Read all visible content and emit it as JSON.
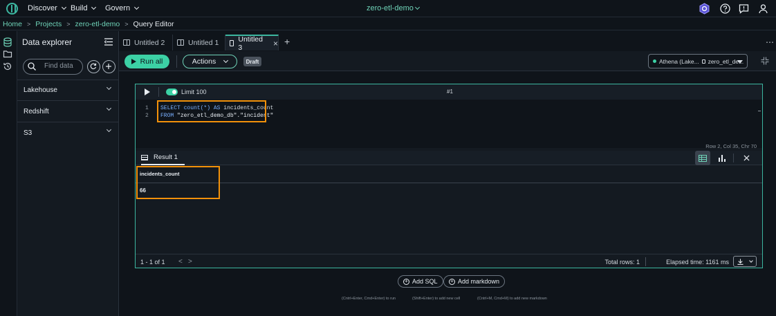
{
  "topnav": {
    "discover": "Discover",
    "build": "Build",
    "govern": "Govern",
    "project": "zero-etl-demo"
  },
  "breadcrumb": {
    "home": "Home",
    "projects": "Projects",
    "project": "zero-etl-demo",
    "current": "Query Editor",
    "separator": ">"
  },
  "explorer": {
    "title": "Data explorer",
    "search_placeholder": "Find data",
    "sections": [
      "Lakehouse",
      "Redshift",
      "S3"
    ]
  },
  "tabs": [
    {
      "label": "Untitled 2"
    },
    {
      "label": "Untitled 1"
    },
    {
      "label": "Untitled 3"
    }
  ],
  "tab_add": "+",
  "tab_close": "×",
  "tab_more": "⋯",
  "toolbar": {
    "run_all": "Run all",
    "actions": "Actions",
    "draft": "Draft",
    "connection": "Athena (Lake...",
    "database": "zero_etl_de..."
  },
  "cell": {
    "limit": "Limit 100",
    "number": "#1",
    "line_numbers": [
      "1",
      "2"
    ],
    "code_line1_kw1": "SELECT",
    "code_line1_fn": "count(*)",
    "code_line1_kw2": "AS",
    "code_line1_rest": "incidents_count",
    "code_line2_kw": "FROM",
    "code_line2_rest": "\"zero_etl_demo_db\".\"incident\"",
    "status": "Row 2,  Col 35,  Chr 70"
  },
  "result": {
    "tab_label": "Result 1",
    "column": "incidents_count",
    "value": "66",
    "pagination": "1 - 1 of 1",
    "prev": "<",
    "next": ">",
    "total_rows": "Total rows: 1",
    "elapsed": "Elapsed time: 1161 ms"
  },
  "add": {
    "sql": "Add SQL",
    "markdown": "Add markdown"
  },
  "hints": {
    "run": "(Cntrl+Enter, Cmd+Enter) to run",
    "new_cell": "(Shift+Enter) to add new cell",
    "markdown": "(Cntrl+M, Cmd+M) to add new markdown"
  },
  "colors": {
    "accent": "#3cd1a5",
    "highlight": "#f2910a",
    "background": "#0f141a"
  }
}
